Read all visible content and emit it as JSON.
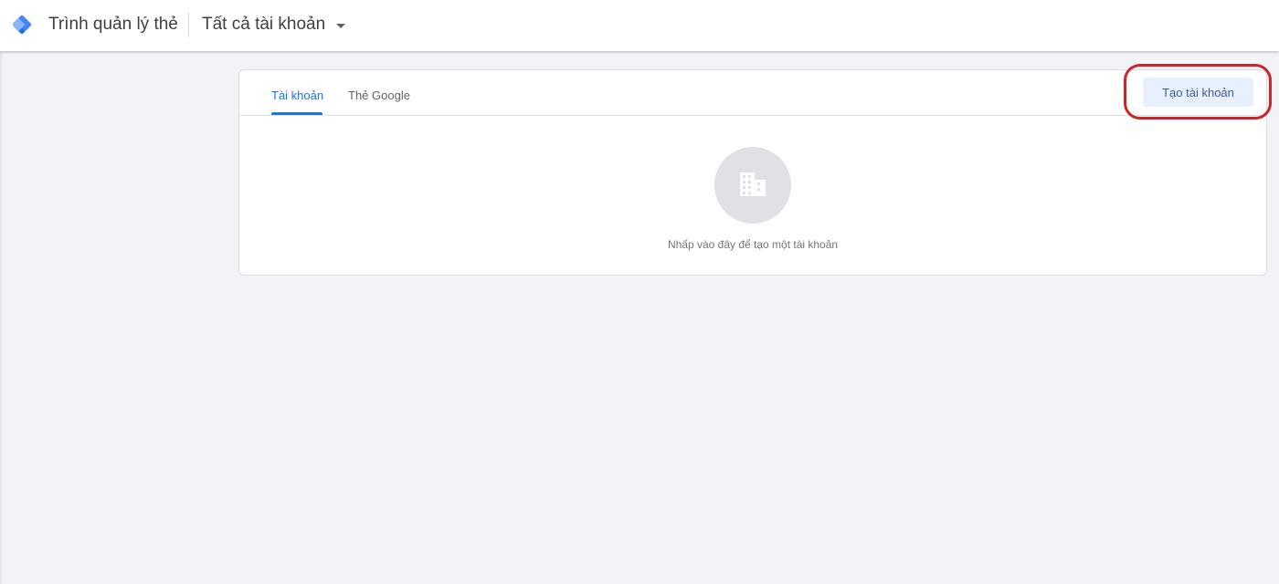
{
  "header": {
    "app_title": "Trình quản lý thẻ",
    "account_switcher_label": "Tất cả tài khoản",
    "logo_icon": "tag-manager-logo-icon",
    "dropdown_icon": "caret-down-icon"
  },
  "tabs": [
    {
      "label": "Tài khoản",
      "active": true
    },
    {
      "label": "Thẻ Google",
      "active": false
    }
  ],
  "actions": {
    "create_account_label": "Tạo tài khoản"
  },
  "empty_state": {
    "icon": "building-icon",
    "message": "Nhấp vào đây để tạo một tài khoản"
  },
  "colors": {
    "accent": "#1a73e8",
    "highlight_ring": "#c9262b",
    "button_bg": "#e8f0fe"
  }
}
